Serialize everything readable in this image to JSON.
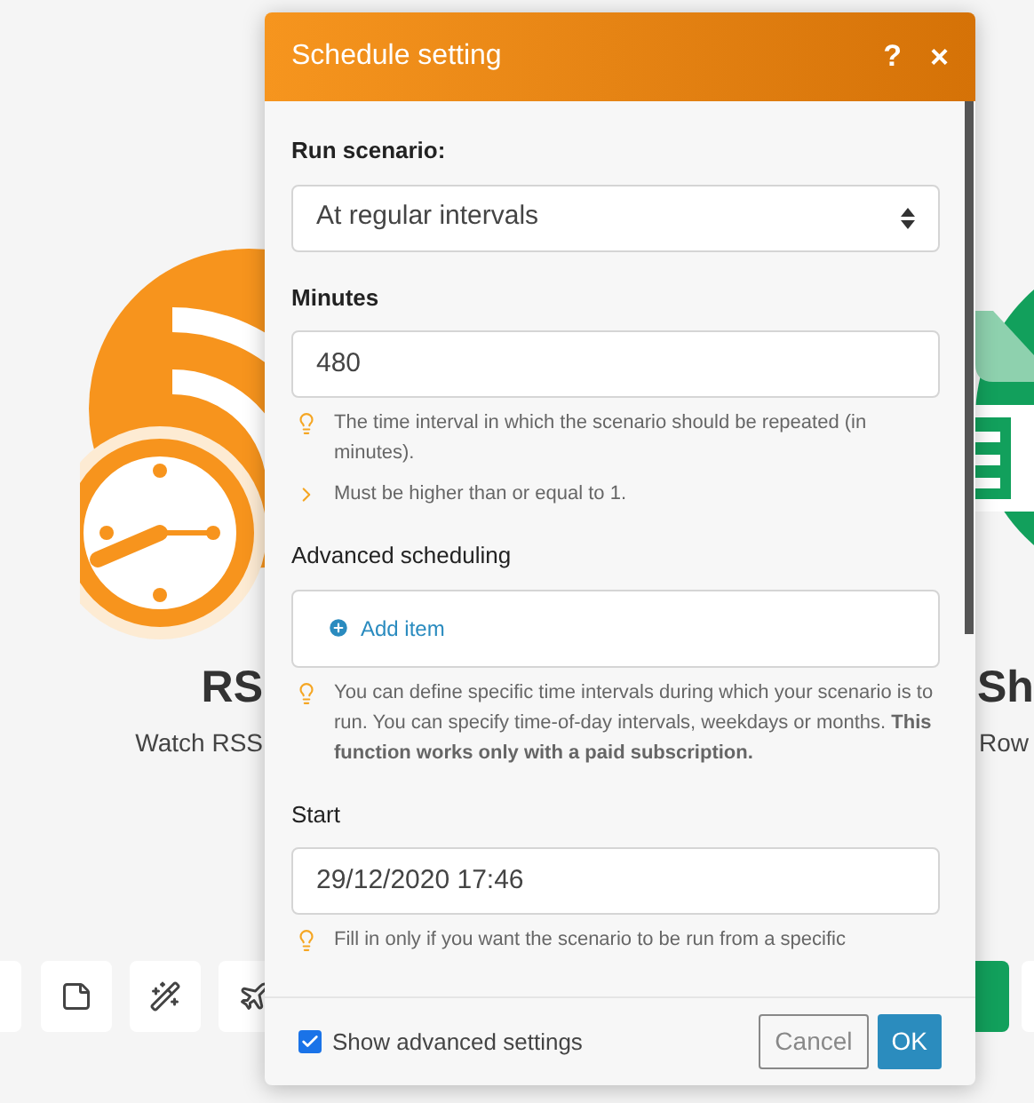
{
  "canvas": {
    "modules": [
      {
        "kind": "rss",
        "title": "RS",
        "subtitle": "Watch RSS"
      },
      {
        "kind": "sheets",
        "title": "Sh",
        "subtitle": "Row"
      }
    ]
  },
  "dialog": {
    "title": "Schedule setting",
    "help": "?",
    "close": "×",
    "fields": [
      {
        "kind": "select",
        "label": "Run scenario:",
        "bold": true,
        "value": "At regular intervals"
      },
      {
        "kind": "input",
        "label": "Minutes",
        "bold": true,
        "value": "480",
        "hints": [
          {
            "kind": "tip",
            "text": "The time interval in which the scenario should be repeated (in minutes)."
          },
          {
            "kind": "rule",
            "text": "Must be higher than or equal to 1."
          }
        ]
      },
      {
        "kind": "repeater",
        "label": "Advanced scheduling",
        "bold": false,
        "action": "Add item",
        "hints": [
          {
            "kind": "tip",
            "text": "You can define specific time intervals during which your scenario is to run. You can specify time-of-day intervals, weekdays or months. **This function works only with a paid subscription.**"
          }
        ]
      },
      {
        "kind": "input",
        "label": "Start",
        "bold": false,
        "value": "29/12/2020 17:46",
        "hints": [
          {
            "kind": "tip",
            "text": "Fill in only if you want the scenario to be run from a specific"
          }
        ]
      }
    ],
    "advanced": {
      "label": "Show advanced settings",
      "checked": true
    },
    "buttons": [
      {
        "label": "Cancel",
        "kind": "secondary"
      },
      {
        "label": "OK",
        "kind": "primary"
      }
    ]
  }
}
